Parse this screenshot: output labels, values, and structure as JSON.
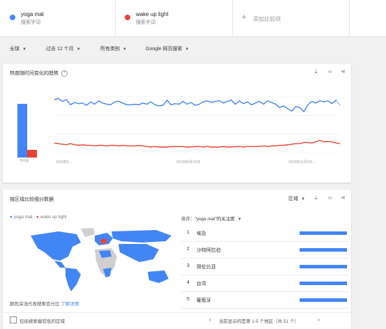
{
  "terms": [
    {
      "name": "yoga mat",
      "sub": "搜索字词",
      "color": "#4285f4"
    },
    {
      "name": "wake up light",
      "sub": "搜索字词",
      "color": "#ea4335"
    }
  ],
  "add_compare": "添加比较项",
  "add_icon": "plus-icon",
  "filters": {
    "region": "全球",
    "time": "过去 12 个月",
    "category": "所有类别",
    "search_type": "Google 网页搜索"
  },
  "trend_card": {
    "title": "热度随时间变化的趋势",
    "avg_label": "平均值",
    "x_labels": [
      "2019年1...",
      "2019年6月16日",
      "2019年11月3日..."
    ],
    "y_labels": [
      "",
      "",
      "",
      ""
    ]
  },
  "chart_data": {
    "type": "line",
    "title": "热度随时间变化的趋势",
    "xlabel": "",
    "ylabel": "",
    "ylim": [
      0,
      100
    ],
    "x_ticks": [
      "2019年1...",
      "2019年6月16日",
      "2019年11月3日..."
    ],
    "averages": {
      "yoga mat": 82,
      "wake up light": 12
    },
    "series": [
      {
        "name": "yoga mat",
        "color": "#4285f4",
        "values": [
          94,
          96,
          91,
          94,
          85,
          89,
          87,
          88,
          84,
          90,
          86,
          92,
          88,
          86,
          85,
          90,
          91,
          88,
          85,
          85,
          86,
          85,
          88,
          86,
          90,
          85,
          83,
          84,
          93,
          85,
          87,
          86,
          91,
          86,
          89,
          84,
          86,
          90,
          92,
          89,
          91,
          92,
          88,
          91,
          93,
          86,
          92,
          87,
          90,
          85,
          88,
          91,
          86,
          92,
          89,
          86,
          80,
          83,
          78,
          74,
          82,
          80,
          73,
          85,
          91,
          88,
          92,
          90,
          92,
          87,
          93,
          84
        ]
      },
      {
        "name": "wake up light",
        "color": "#ea4335",
        "values": [
          18,
          17,
          16,
          15,
          17,
          15,
          14,
          15,
          14,
          14,
          13,
          14,
          14,
          13,
          14,
          14,
          13,
          14,
          13,
          13,
          13,
          14,
          13,
          12,
          11,
          12,
          11,
          11,
          11,
          12,
          12,
          12,
          12,
          11,
          11,
          12,
          12,
          11,
          12,
          11,
          11,
          11,
          12,
          11,
          11,
          12,
          12,
          11,
          12,
          12,
          12,
          12,
          13,
          12,
          13,
          13,
          14,
          14,
          15,
          16,
          17,
          17,
          19,
          19,
          18,
          20,
          23,
          20,
          21,
          20,
          18,
          17
        ]
      }
    ]
  },
  "region_card": {
    "title": "按区域比较细分数据",
    "region_select": "区域",
    "legend": [
      "yoga mat",
      "wake up light"
    ],
    "sort_label": "排序：",
    "sort_value": "\"yoga mat\"的关注度",
    "color_note": "颜色深浅代表搜索百分比",
    "learn_more": "了解详情",
    "include_low": "包括搜索量较低的区域",
    "pagination": "当前显示的是第 1-5 个地区（共 51 个）",
    "rows": [
      {
        "rank": "1",
        "name": "埃及",
        "value": 100
      },
      {
        "rank": "2",
        "name": "沙特阿拉伯",
        "value": 100
      },
      {
        "rank": "3",
        "name": "哥伦比亚",
        "value": 100
      },
      {
        "rank": "4",
        "name": "台湾",
        "value": 100
      },
      {
        "rank": "5",
        "name": "葡萄牙",
        "value": 100
      }
    ]
  },
  "icons": {
    "download": "download-icon",
    "embed": "embed-icon",
    "share": "share-icon",
    "help": "help-icon",
    "prev": "chevron-left-icon",
    "next": "chevron-right-icon"
  }
}
